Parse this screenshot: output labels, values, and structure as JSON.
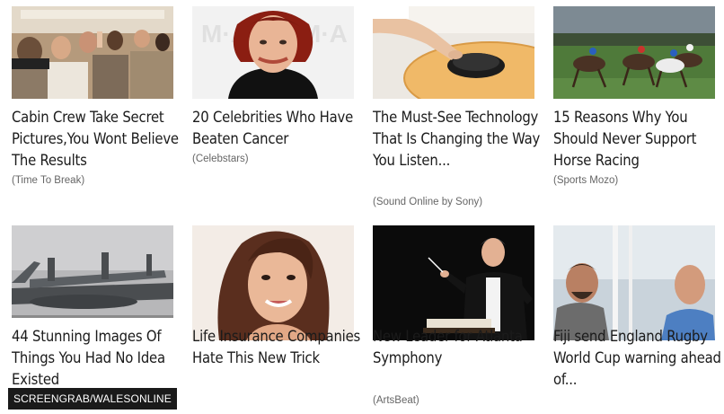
{
  "cards": [
    {
      "title": "Cabin Crew Take Secret Pictures,You Wont Believe The Results",
      "source": "(Time To Break)",
      "image": "airplane-cabin-passengers"
    },
    {
      "title": "20 Celebrities Who Have Beaten Cancer",
      "source": "(Celebstars)",
      "image": "red-haired-woman-portrait"
    },
    {
      "title": "The Must-See Technology That Is Changing the Way You Listen...",
      "source": "(Sound Online by Sony)",
      "image": "hand-with-headphones-on-table"
    },
    {
      "title": "15 Reasons Why You Should Never Support Horse Racing",
      "source": "(Sports Mozo)",
      "image": "horse-race"
    },
    {
      "title": "44 Stunning Images Of Things You Had No Idea Existed",
      "source": "",
      "image": "giant-seaplane"
    },
    {
      "title": "Life Insurance Companies Hate This New Trick",
      "source": "",
      "image": "smiling-woman-portrait"
    },
    {
      "title": "New Leader for Atlanta Symphony",
      "source": "(ArtsBeat)",
      "image": "orchestra-conductor"
    },
    {
      "title": "Fiji send England Rugby World Cup warning ahead of...",
      "source": "",
      "image": "two-men-in-stadium"
    }
  ],
  "watermark": "SCREENGRAB/WALESONLINE"
}
